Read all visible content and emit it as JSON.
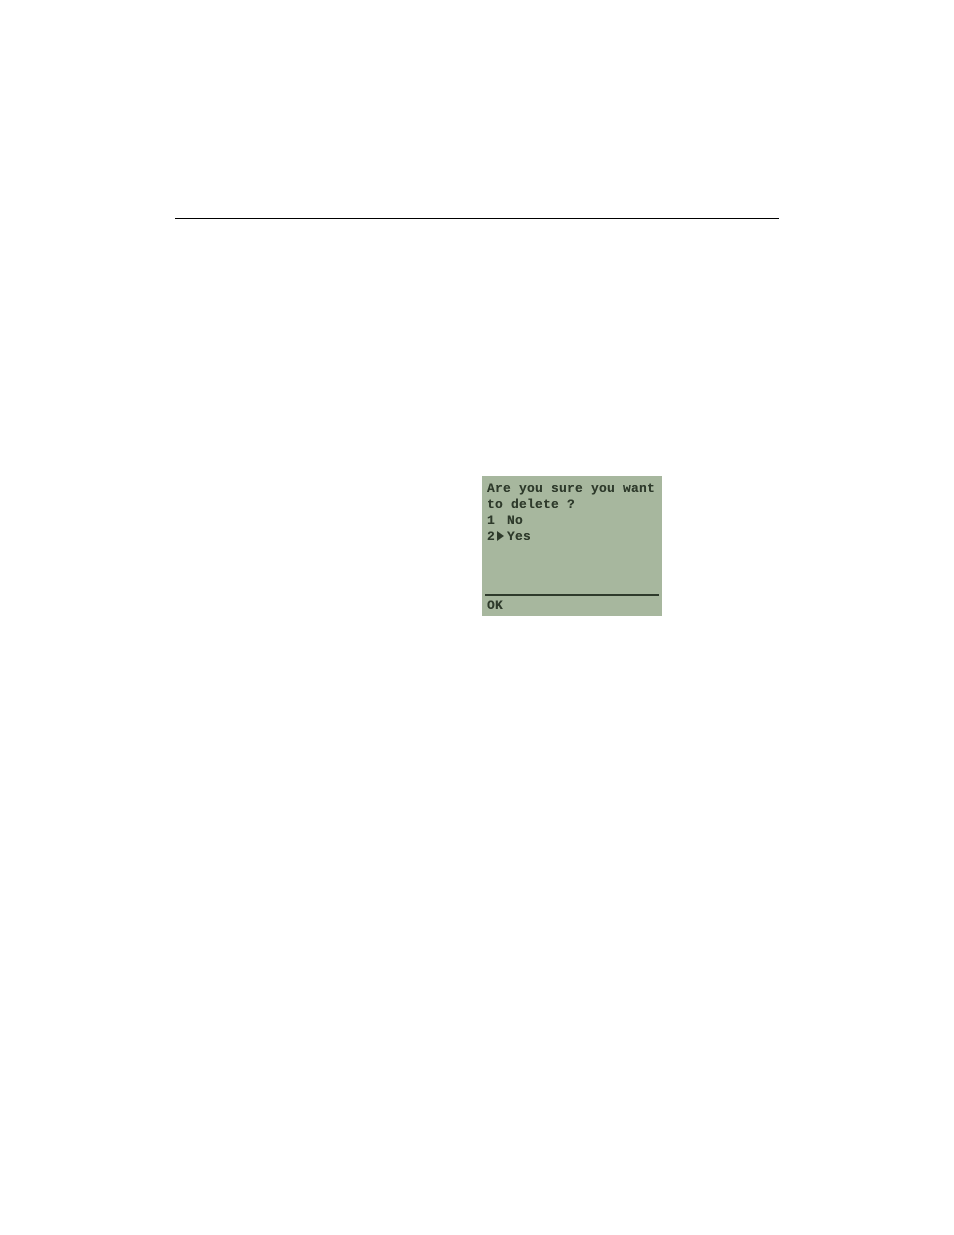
{
  "lcd": {
    "prompt_line1": "Are you sure you want",
    "prompt_line2": "to delete ?",
    "options": [
      {
        "num": "1",
        "label": "No",
        "selected": false
      },
      {
        "num": "2",
        "label": "Yes",
        "selected": true
      }
    ],
    "softkey_left": "OK"
  }
}
